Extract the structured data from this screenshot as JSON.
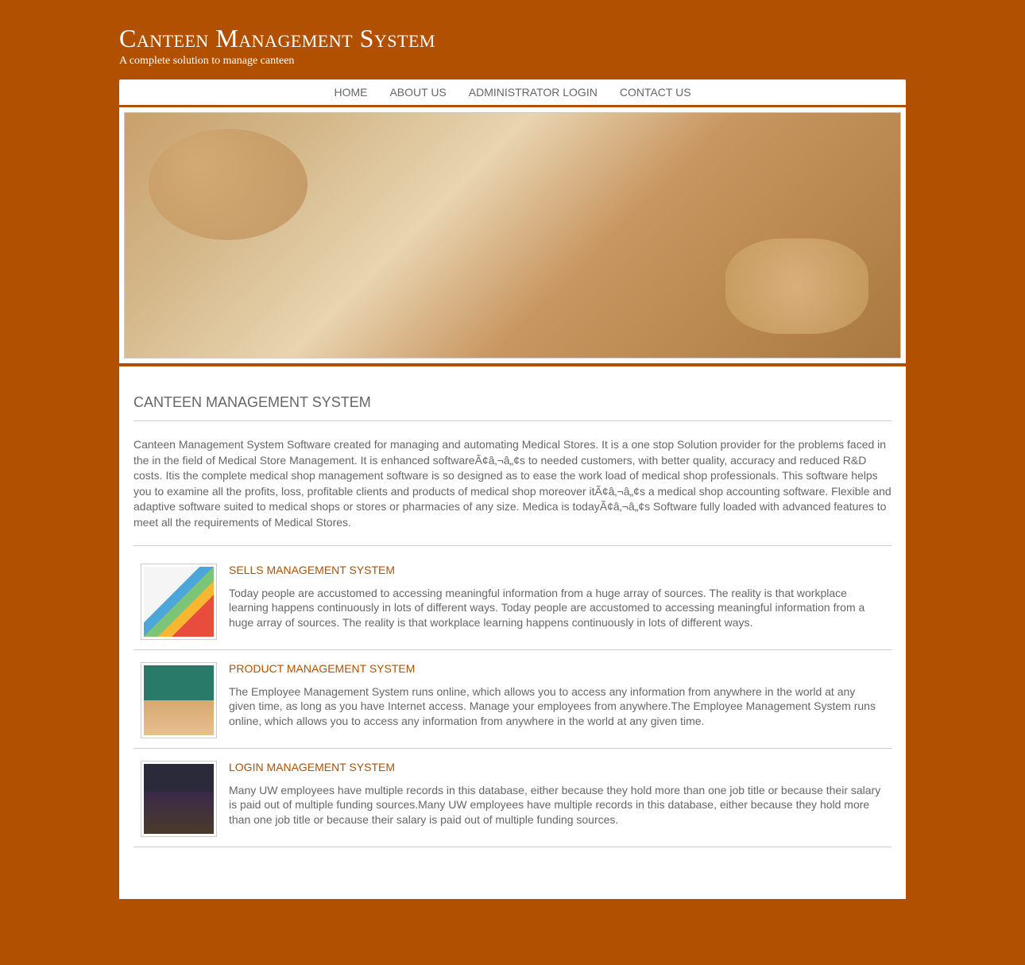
{
  "header": {
    "title": "Canteen Management System",
    "tagline": "A complete solution to manage canteen"
  },
  "nav": {
    "items": [
      "HOME",
      "ABOUT US",
      "ADMINISTRATOR LOGIN",
      "CONTACT US"
    ]
  },
  "main": {
    "page_title": "CANTEEN MANAGEMENT SYSTEM",
    "intro": "Canteen Management System Software created for managing and automating Medical Stores. It is a one stop Solution provider for the problems faced in the in the field of Medical Store Management. It is enhanced softwareÃ¢â‚¬â„¢s to needed customers, with better quality, accuracy and reduced R&D costs. Itis the complete medical shop management software is so designed as to ease the work load of medical shop professionals. This software helps you to examine all the profits, loss, profitable clients and products of medical shop moreover itÃ¢â‚¬â„¢s a medical shop accounting software. Flexible and adaptive software suited to medical shops or stores or pharmacies of any size. Medica is todayÃ¢â‚¬â„¢s Software fully loaded with advanced features to meet all the requirements of Medical Stores."
  },
  "features": [
    {
      "title": "SELLS MANAGEMENT SYSTEM",
      "desc": "Today people are accustomed to accessing meaningful information from a huge array of sources. The reality is that workplace learning happens continuously in lots of different ways. Today people are accustomed to accessing meaningful information from a huge array of sources. The reality is that workplace learning happens continuously in lots of different ways."
    },
    {
      "title": "PRODUCT MANAGEMENT SYSTEM",
      "desc": "The Employee Management System runs online, which allows you to access any information from anywhere in the world at any given time, as long as you have Internet access. Manage your employees from anywhere.The Employee Management System runs online, which allows you to access any information from anywhere in the world at any given time."
    },
    {
      "title": "LOGIN MANAGEMENT SYSTEM",
      "desc": "Many UW employees have multiple records in this database, either because they hold more than one job title or because their salary is paid out of multiple funding sources.Many UW employees have multiple records in this database, either because they hold more than one job title or because their salary is paid out of multiple funding sources."
    }
  ]
}
